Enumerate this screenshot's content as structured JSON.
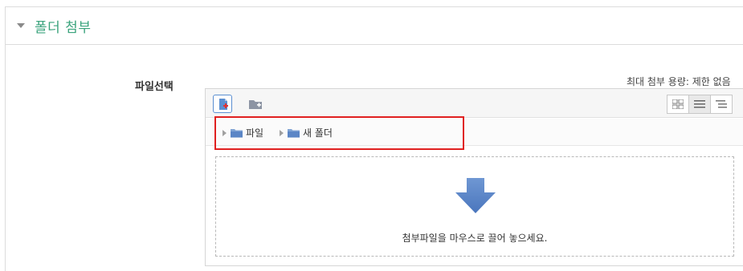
{
  "section": {
    "title": "폴더 첨부"
  },
  "field": {
    "label": "파일선택"
  },
  "filemanager": {
    "max_size_text": "최대 첨부 용량: 제한 없음",
    "path": [
      "파일",
      "새 폴더"
    ],
    "drop_text": "첨부파일을 마우스로 끌어 놓으세요."
  },
  "icons": {
    "collapse": "caret-down-icon",
    "add_file": "add-file-icon",
    "create_folder": "create-folder-icon",
    "view_icons": "grid-view-icon",
    "view_details": "list-view-icon",
    "view_tree": "tree-view-icon",
    "path_folder": "folder-icon",
    "drop": "down-arrow-icon"
  },
  "colors": {
    "title": "#3aa37c",
    "highlight": "#e02020",
    "arrow": "#5a86c8"
  }
}
